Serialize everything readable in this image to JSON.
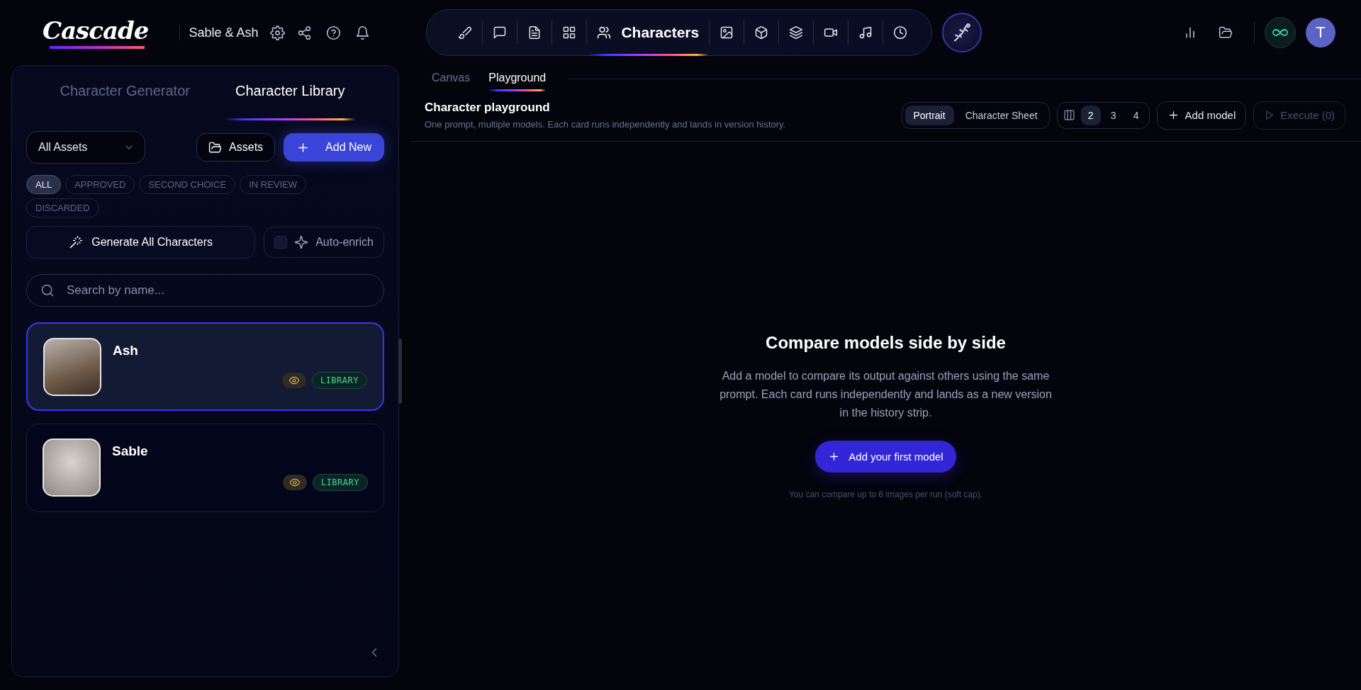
{
  "topbar": {
    "logo": "Cascade",
    "project": "Sable & Ash",
    "nav": [
      {
        "selected": false
      },
      {
        "selected": false
      },
      {
        "selected": false
      },
      {
        "selected": false
      },
      {
        "label": "Characters",
        "selected": true
      },
      {
        "selected": false
      },
      {
        "selected": false
      },
      {
        "selected": false
      },
      {
        "selected": false
      },
      {
        "selected": false
      },
      {
        "selected": false
      }
    ],
    "avatar": "T"
  },
  "library": {
    "tabs": [
      {
        "label": "Character Generator",
        "selected": false
      },
      {
        "label": "Character Library",
        "selected": true
      }
    ],
    "asset_filter": "All Assets",
    "assets_button": "Assets",
    "add_button": "Add New",
    "chips": [
      {
        "label": "ALL",
        "selected": true
      },
      {
        "label": "APPROVED",
        "selected": false
      },
      {
        "label": "SECOND CHOICE",
        "selected": false
      },
      {
        "label": "IN REVIEW",
        "selected": false
      },
      {
        "label": "DISCARDED",
        "selected": false
      }
    ],
    "generate_button": "Generate All Characters",
    "auto_enrich": {
      "label": "Auto-enrich",
      "checked": false
    },
    "search": {
      "placeholder": "Search by name..."
    },
    "characters": [
      {
        "name": "Ash",
        "selected": true,
        "badge": "LIBRARY"
      },
      {
        "name": "Sable",
        "selected": false,
        "badge": "LIBRARY"
      }
    ]
  },
  "playground": {
    "tabs": [
      {
        "label": "Canvas",
        "selected": false
      },
      {
        "label": "Playground",
        "selected": true
      }
    ],
    "title": "Character playground",
    "subtitle": "One prompt, multiple models. Each card runs independently and lands in version history.",
    "views": [
      {
        "label": "Portrait",
        "selected": true
      },
      {
        "label": "Character Sheet",
        "selected": false
      }
    ],
    "columns": [
      {
        "label": "2",
        "selected": true
      },
      {
        "label": "3",
        "selected": false
      },
      {
        "label": "4",
        "selected": false
      }
    ],
    "add_model": "Add model",
    "execute": {
      "label": "Execute (0)",
      "disabled": true
    },
    "empty": {
      "title": "Compare models side by side",
      "body": "Add a model to compare its output against others using the same prompt. Each card runs independently and lands as a new version in the history strip.",
      "button": "Add your first model",
      "note": "You can compare up to 6 images per run (soft cap)."
    }
  }
}
